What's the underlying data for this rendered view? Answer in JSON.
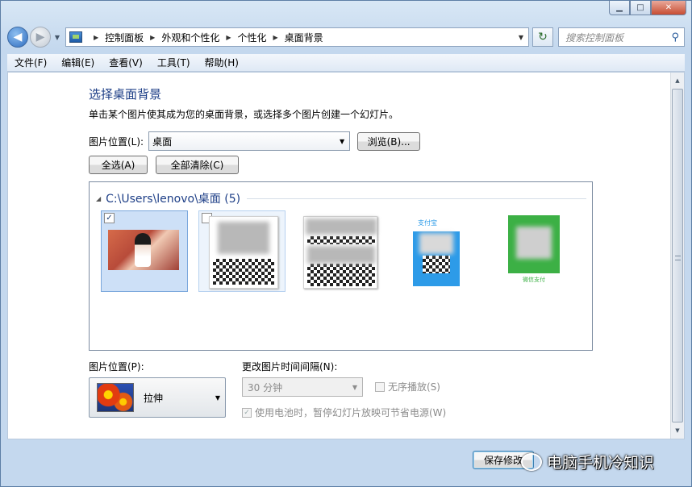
{
  "window": {
    "caption": {
      "minimize": "▁",
      "maximize": "□",
      "close": "✕"
    }
  },
  "address": {
    "crumbs": [
      "控制面板",
      "外观和个性化",
      "个性化",
      "桌面背景"
    ]
  },
  "search": {
    "placeholder": "搜索控制面板"
  },
  "menu": [
    "文件(F)",
    "编辑(E)",
    "查看(V)",
    "工具(T)",
    "帮助(H)"
  ],
  "page": {
    "title": "选择桌面背景",
    "description": "单击某个图片使其成为您的桌面背景，或选择多个图片创建一个幻灯片。"
  },
  "location": {
    "label": "图片位置(L):",
    "value": "桌面",
    "browse": "浏览(B)..."
  },
  "buttons": {
    "select_all": "全选(A)",
    "clear_all": "全部清除(C)"
  },
  "gallery": {
    "group_label": "C:\\Users\\lenovo\\桌面 (5)",
    "items": [
      {
        "checked": true,
        "check_mark": "✓"
      },
      {
        "checked": false
      },
      {
        "checked": false
      },
      {
        "checked": false
      },
      {
        "checked": false
      }
    ]
  },
  "position": {
    "label": "图片位置(P):",
    "value": "拉伸"
  },
  "interval": {
    "label": "更改图片时间间隔(N):",
    "value": "30 分钟"
  },
  "shuffle": {
    "label": "无序播放(S)",
    "checked": false
  },
  "battery": {
    "label": "使用电池时，暂停幻灯片放映可节省电源(W)",
    "checked": true,
    "check_mark": "✓"
  },
  "footer": {
    "save": "保存修改"
  },
  "watermark": {
    "text": "电脑手机冷知识"
  }
}
